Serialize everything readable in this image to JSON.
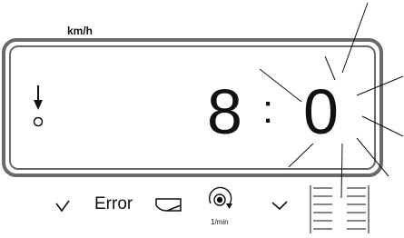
{
  "display": {
    "unit_label": "km/h",
    "digit_main": "8",
    "digit_separator": ":",
    "digit_blinking": "0"
  },
  "symbols": {
    "error_label": "Error",
    "rpm_unit_label": "1/min",
    "icons": [
      "check-left-icon",
      "error-label",
      "tray-icon",
      "rotation-sensor-icon",
      "check-right-icon",
      "level-gauge-icon"
    ]
  },
  "indicator": {
    "left_arrow_icon": "arrow-down-icon",
    "left_circle_icon": "circle-icon"
  },
  "colors": {
    "frame": "#6a6a6a",
    "ink": "#111111",
    "background": "#ffffff"
  }
}
